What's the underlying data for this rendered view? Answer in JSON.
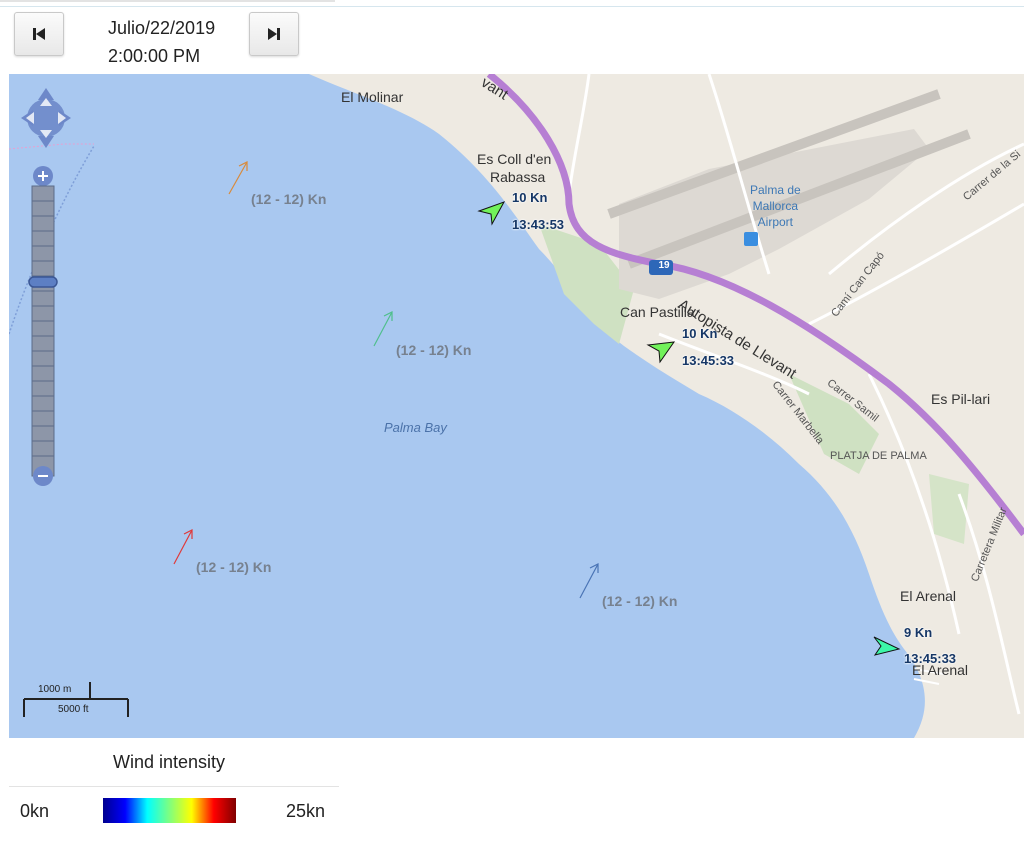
{
  "header": {
    "date": "Julio/22/2019",
    "time": "2:00:00 PM"
  },
  "map": {
    "places": {
      "el_molinar": "El Molinar",
      "es_coll_1": "Es Coll d'en",
      "es_coll_2": "Rabassa",
      "can_pastilla": "Can Pastilla",
      "es_pil_lari": "Es Pil-lari",
      "el_arenal": "El Arenal",
      "el_arenal_2": "El Arenal",
      "platja": "PLATJA DE PALMA",
      "bay": "Palma Bay",
      "airport_1": "Palma de",
      "airport_2": "Mallorca",
      "airport_3": "Airport"
    },
    "roads": {
      "autopista": "Autopista de Llevant",
      "route_shield": "19",
      "cami_can_capo": "Camí Can Capó",
      "carrer_de_la_si": "Carrer de la Si",
      "carrer_marbella": "Carrer Marbella",
      "carrer_samil": "Carrer Samil",
      "carretera_militar": "Carretera Militar",
      "levant_top": "vant"
    },
    "wind_arrows": [
      {
        "label": "(12 - 12) Kn",
        "color": "#d98a3a"
      },
      {
        "label": "(12 - 12) Kn",
        "color": "#4fbf8c"
      },
      {
        "label": "(12 - 12) Kn",
        "color": "#e0393a"
      },
      {
        "label": "(12 - 12) Kn",
        "color": "#4a74b5"
      }
    ],
    "buoys": [
      {
        "speed": "10 Kn",
        "time": "13:43:53",
        "color": "#72f25a"
      },
      {
        "speed": "10 Kn",
        "time": "13:45:33",
        "color": "#72f25a"
      },
      {
        "speed": "9 Kn",
        "time": "13:45:33",
        "color": "#3cf7a8"
      }
    ],
    "scale": {
      "metric": "1000 m",
      "imperial": "5000 ft"
    }
  },
  "legend": {
    "title": "Wind intensity",
    "min": "0kn",
    "max": "25kn"
  }
}
